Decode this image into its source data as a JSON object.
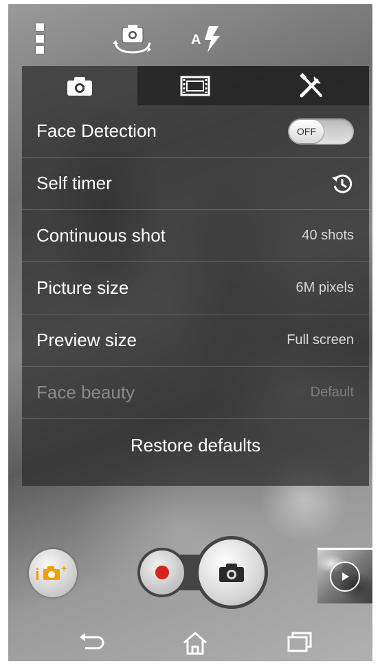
{
  "topbar": {
    "icons": [
      "overflow-menu-icon",
      "switch-camera-icon",
      "auto-flash-icon"
    ],
    "flash_label": "A"
  },
  "tabs": [
    {
      "icon": "camera-icon",
      "active": true
    },
    {
      "icon": "video-film-icon",
      "active": false
    },
    {
      "icon": "tools-icon",
      "active": false
    }
  ],
  "settings": {
    "face_detection": {
      "label": "Face Detection",
      "toggle": "OFF"
    },
    "self_timer": {
      "label": "Self timer",
      "icon": "timer-icon"
    },
    "continuous_shot": {
      "label": "Continuous shot",
      "value": "40 shots"
    },
    "picture_size": {
      "label": "Picture size",
      "value": "6M pixels"
    },
    "preview_size": {
      "label": "Preview size",
      "value": "Full screen"
    },
    "face_beauty": {
      "label": "Face beauty",
      "value": "Default",
      "disabled": true
    }
  },
  "restore_label": "Restore defaults",
  "controls": {
    "smart_icon_text": "i",
    "smart_plus": "+"
  },
  "colors": {
    "accent_orange": "#f0a100",
    "record_red": "#d8221c",
    "panel_bg": "rgba(45,45,45,0.72)"
  },
  "navbar": {
    "icons": [
      "back-icon",
      "home-icon",
      "recent-apps-icon"
    ]
  }
}
